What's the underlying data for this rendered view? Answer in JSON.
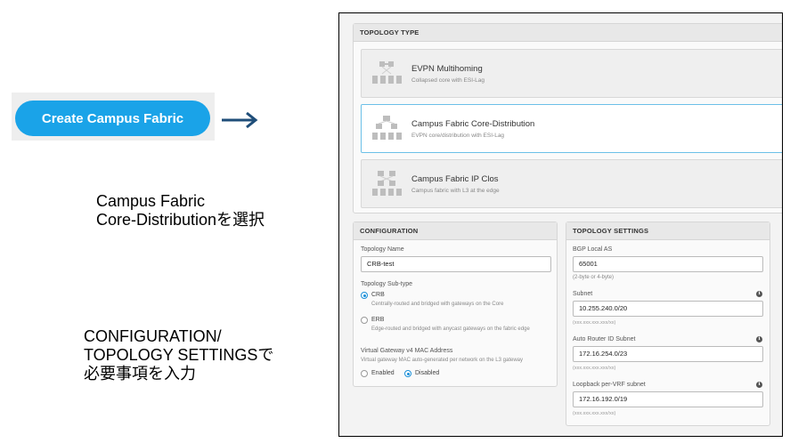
{
  "annotations": {
    "create_button": "Create Campus Fabric",
    "note1_line1": "Campus Fabric",
    "note1_line2": "Core-Distributionを選択",
    "note2_line1": "CONFIGURATION/",
    "note2_line2": "TOPOLOGY SETTINGSで",
    "note2_line3": "必要事項を入力"
  },
  "topology_type": {
    "heading": "TOPOLOGY TYPE",
    "options": [
      {
        "title": "EVPN Multihoming",
        "subtitle": "Collapsed core with ESI-Lag",
        "icon": "evpn-multihoming-icon",
        "selected": false
      },
      {
        "title": "Campus Fabric Core-Distribution",
        "subtitle": "EVPN core/distribution with ESI-Lag",
        "icon": "core-distribution-icon",
        "selected": true
      },
      {
        "title": "Campus Fabric IP Clos",
        "subtitle": "Campus fabric with L3 at the edge",
        "icon": "ip-clos-icon",
        "selected": false
      }
    ]
  },
  "configuration": {
    "heading": "CONFIGURATION",
    "topology_name_label": "Topology Name",
    "topology_name_value": "CRB-test",
    "subtype_label": "Topology Sub-type",
    "crb_label": "CRB",
    "crb_desc": "Centrally-routed and bridged with gateways on the Core",
    "erb_label": "ERB",
    "erb_desc": "Edge-routed and bridged with anycast gateways on the fabric edge",
    "selected_subtype": "CRB",
    "vgw_label": "Virtual Gateway v4 MAC Address",
    "vgw_desc": "Virtual gateway MAC auto-generated per network on the L3 gateway",
    "enabled_label": "Enabled",
    "disabled_label": "Disabled",
    "vgw_selected": "Disabled"
  },
  "topology_settings": {
    "heading": "TOPOLOGY SETTINGS",
    "bgp_label": "BGP Local AS",
    "bgp_value": "65001",
    "bgp_hint": "(2-byte or 4-byte)",
    "subnet_label": "Subnet",
    "subnet_value": "10.255.240.0/20",
    "subnet_hint": "(xxx.xxx.xxx.xxx/xx)",
    "router_id_label": "Auto Router ID Subnet",
    "router_id_value": "172.16.254.0/23",
    "router_id_hint": "(xxx.xxx.xxx.xxx/xx)",
    "loopback_label": "Loopback per-VRF subnet",
    "loopback_value": "172.16.192.0/19",
    "loopback_hint": "(xxx.xxx.xxx.xxx/xx)",
    "info_glyph": "i"
  },
  "colors": {
    "accent": "#1aa3e8",
    "arrow": "#1f4e79",
    "selected_border": "#6cc0e8"
  }
}
